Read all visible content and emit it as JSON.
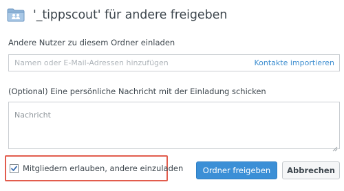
{
  "dialog": {
    "title": "'_tippscout' für andere freigeben",
    "folder_icon": "shared-folder-icon"
  },
  "invite": {
    "label": "Andere Nutzer zu diesem Ordner einladen",
    "placeholder": "Namen oder E-Mail-Adressen hinzufügen",
    "import_link": "Kontakte importieren"
  },
  "message": {
    "label": "(Optional) Eine persönliche Nachricht mit der Einladung schicken",
    "placeholder": "Nachricht"
  },
  "permissions": {
    "checkbox_label": "Mitgliedern erlauben, andere einzuladen",
    "checked": true
  },
  "actions": {
    "share_label": "Ordner freigeben",
    "cancel_label": "Abbrechen"
  },
  "colors": {
    "primary": "#3b8fd6",
    "link": "#3e8ed0",
    "highlight": "#e25c4d"
  }
}
